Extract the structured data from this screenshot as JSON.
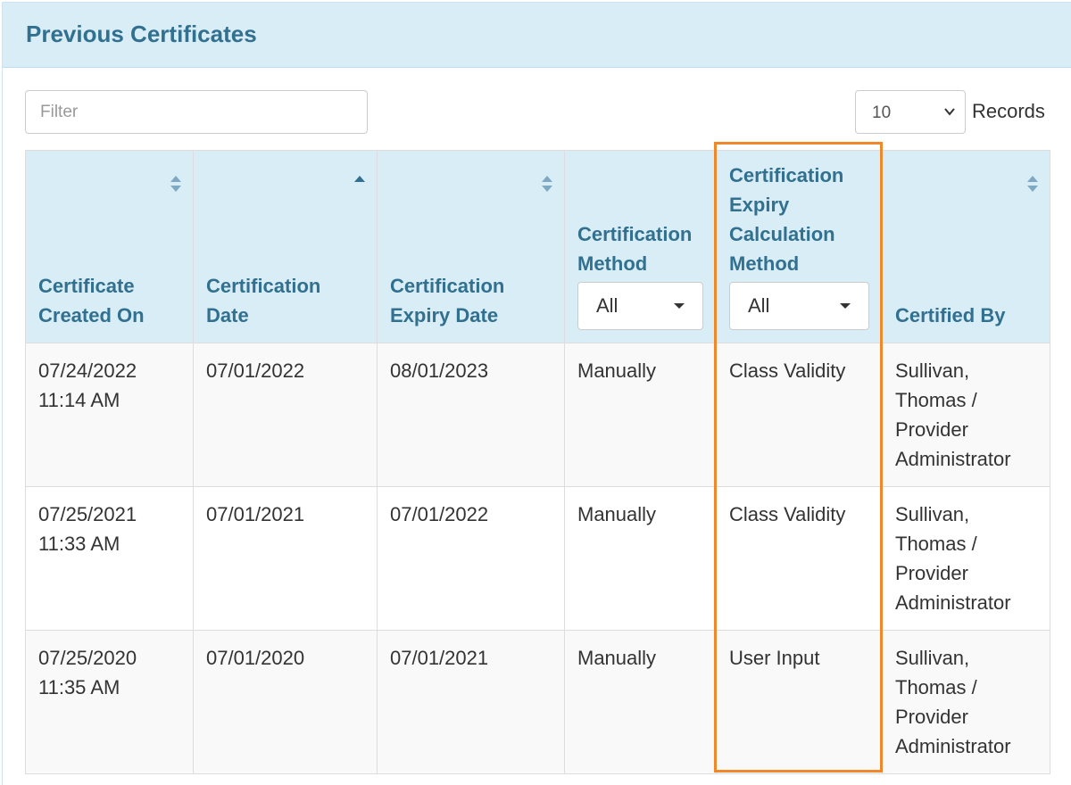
{
  "panel": {
    "title": "Previous Certificates"
  },
  "filter": {
    "placeholder": "Filter",
    "value": ""
  },
  "records": {
    "selected": "10",
    "label": "Records"
  },
  "table": {
    "headers": {
      "created_on": "Certificate Created On",
      "cert_date": "Certification Date",
      "expiry_date": "Certification Expiry Date",
      "method": "Certification Method",
      "calc_method": "Certification Expiry Calculation Method",
      "certified_by": "Certified By"
    },
    "filters": {
      "method": "All",
      "calc_method": "All"
    },
    "rows": [
      {
        "created_on": "07/24/2022 11:14 AM",
        "cert_date": "07/01/2022",
        "expiry_date": "08/01/2023",
        "method": "Manually",
        "calc_method": "Class Validity",
        "certified_by": "Sullivan, Thomas / Provider Administrator"
      },
      {
        "created_on": "07/25/2021 11:33 AM",
        "cert_date": "07/01/2021",
        "expiry_date": "07/01/2022",
        "method": "Manually",
        "calc_method": "Class Validity",
        "certified_by": "Sullivan, Thomas / Provider Administrator"
      },
      {
        "created_on": "07/25/2020 11:35 AM",
        "cert_date": "07/01/2020",
        "expiry_date": "07/01/2021",
        "method": "Manually",
        "calc_method": "User Input",
        "certified_by": "Sullivan, Thomas / Provider Administrator"
      }
    ]
  },
  "colors": {
    "header_bg": "#d9edf7",
    "header_text": "#31708f",
    "highlight_border": "#f0882b",
    "row_alt_bg": "#f9f9f9"
  },
  "icons": {
    "sortable": "sort-both-icon",
    "sorted_asc": "sort-asc-icon",
    "select_chevron": "chevron-down-icon",
    "dropdown_caret": "caret-down-icon"
  }
}
